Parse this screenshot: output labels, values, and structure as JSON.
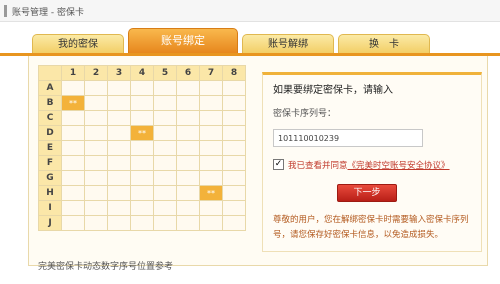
{
  "breadcrumb": "账号管理 - 密保卡",
  "tabs": [
    {
      "label": "我的密保"
    },
    {
      "label": "账号绑定"
    },
    {
      "label": "账号解绑"
    },
    {
      "label": "换　卡"
    }
  ],
  "grid": {
    "columns": [
      "1",
      "2",
      "3",
      "4",
      "5",
      "6",
      "7",
      "8"
    ],
    "rows": [
      "A",
      "B",
      "C",
      "D",
      "E",
      "F",
      "G",
      "H",
      "I",
      "J"
    ],
    "highlighted": [
      {
        "row": "B",
        "col": "1",
        "text": "**"
      },
      {
        "row": "D",
        "col": "4",
        "text": "**"
      },
      {
        "row": "H",
        "col": "7",
        "text": "**"
      }
    ]
  },
  "form": {
    "title": "如果要绑定密保卡，请输入",
    "serial_label": "密保卡序列号：",
    "serial_value": "101110010239",
    "agree_prefix": "我已查看并同意",
    "agree_link": "《完美时空账号安全协议》",
    "next_label": "下一步",
    "note": "尊敬的用户，您在解绑密保卡时需要输入密保卡序列号，请您保存好密保卡信息，以免造成损失。"
  },
  "caption": "完美密保卡动态数字序号位置参考"
}
